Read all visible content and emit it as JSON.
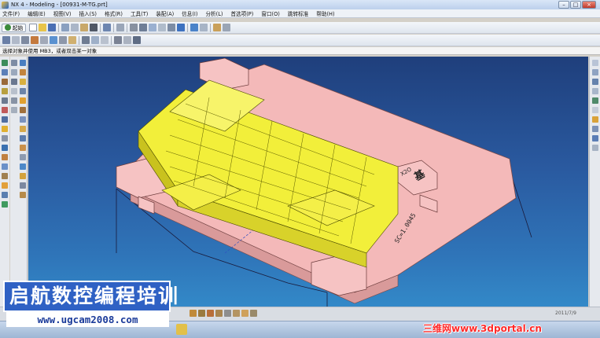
{
  "window": {
    "title": "NX 4 - Modeling - [00931-M-TG.prt]",
    "minimize": "–",
    "maximize": "□",
    "close": "×"
  },
  "menu": [
    {
      "label": "文件(F)"
    },
    {
      "label": "编辑(E)"
    },
    {
      "label": "视图(V)"
    },
    {
      "label": "插入(S)"
    },
    {
      "label": "格式(R)"
    },
    {
      "label": "工具(T)"
    },
    {
      "label": "装配(A)"
    },
    {
      "label": "信息(I)"
    },
    {
      "label": "分析(L)"
    },
    {
      "label": "首选项(P)"
    },
    {
      "label": "窗口(O)"
    },
    {
      "label": "跳转标准"
    },
    {
      "label": "帮助(H)"
    }
  ],
  "toolbar": {
    "start_label": "起始",
    "start_icon": "gear-icon"
  },
  "cue_line": "选择对象并使用 MB3，或者双击某一对象",
  "model_labels": {
    "side_text": "SC=1.0045",
    "corner_text": "基",
    "corner_text2": "X2O"
  },
  "status": {
    "date": "2011/7/9"
  },
  "watermark": {
    "school_title": "启航数控编程培训",
    "school_url": "www.ugcam2008.com",
    "portal_text": "三维网www.3dportal.cn"
  },
  "colors": {
    "viewport_top": "#1f3f7c",
    "viewport_bottom": "#3389c8",
    "plate": "#f4b9b9",
    "part": "#f2ef3a",
    "banner": "#2f61c4"
  }
}
